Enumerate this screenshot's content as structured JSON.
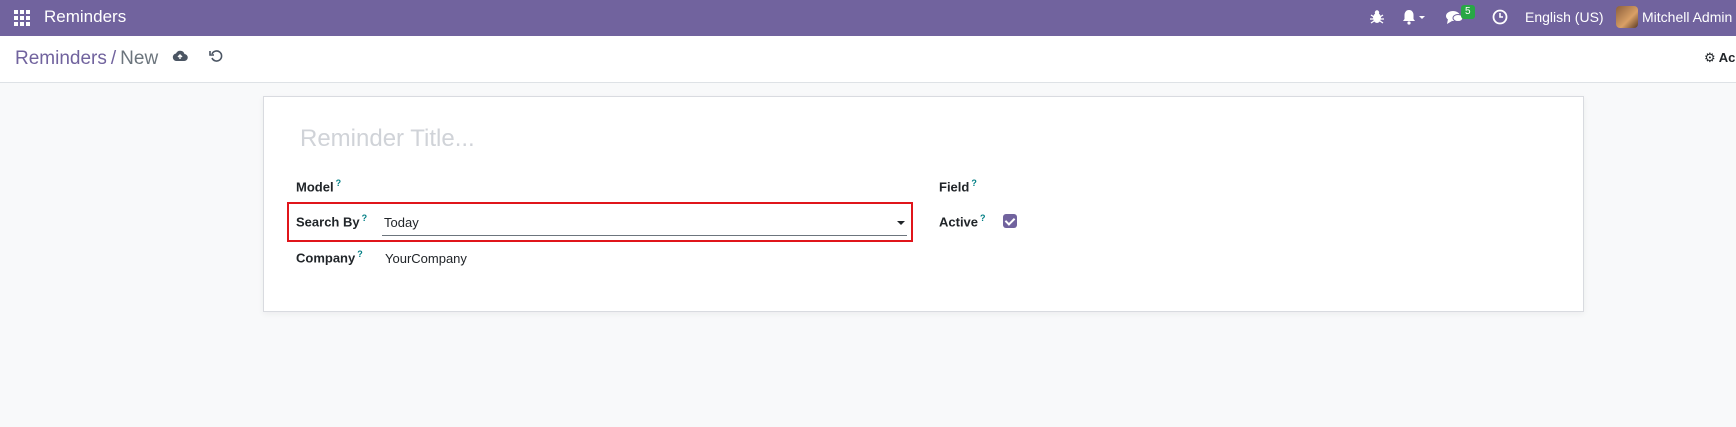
{
  "navbar": {
    "app_name": "Reminders",
    "badge_count": "5",
    "language": "English (US)",
    "user": "Mitchell Admin (",
    "icons": [
      "apps-grid-icon",
      "bug-icon",
      "bell-icon",
      "chat-icon",
      "clock-icon"
    ]
  },
  "control": {
    "breadcrumb_root": "Reminders",
    "breadcrumb_sep": "/",
    "breadcrumb_current": "New",
    "action_label": "Ac"
  },
  "form": {
    "title_placeholder": "Reminder Title...",
    "model_label": "Model",
    "search_by_label": "Search By",
    "search_by_value": "Today",
    "company_label": "Company",
    "company_value": "YourCompany",
    "field_label": "Field",
    "active_label": "Active",
    "active_checked": true,
    "help_mark": "?"
  },
  "colors": {
    "navbar": "#71639e",
    "highlight": "#e0151b",
    "badge": "#28a745"
  }
}
